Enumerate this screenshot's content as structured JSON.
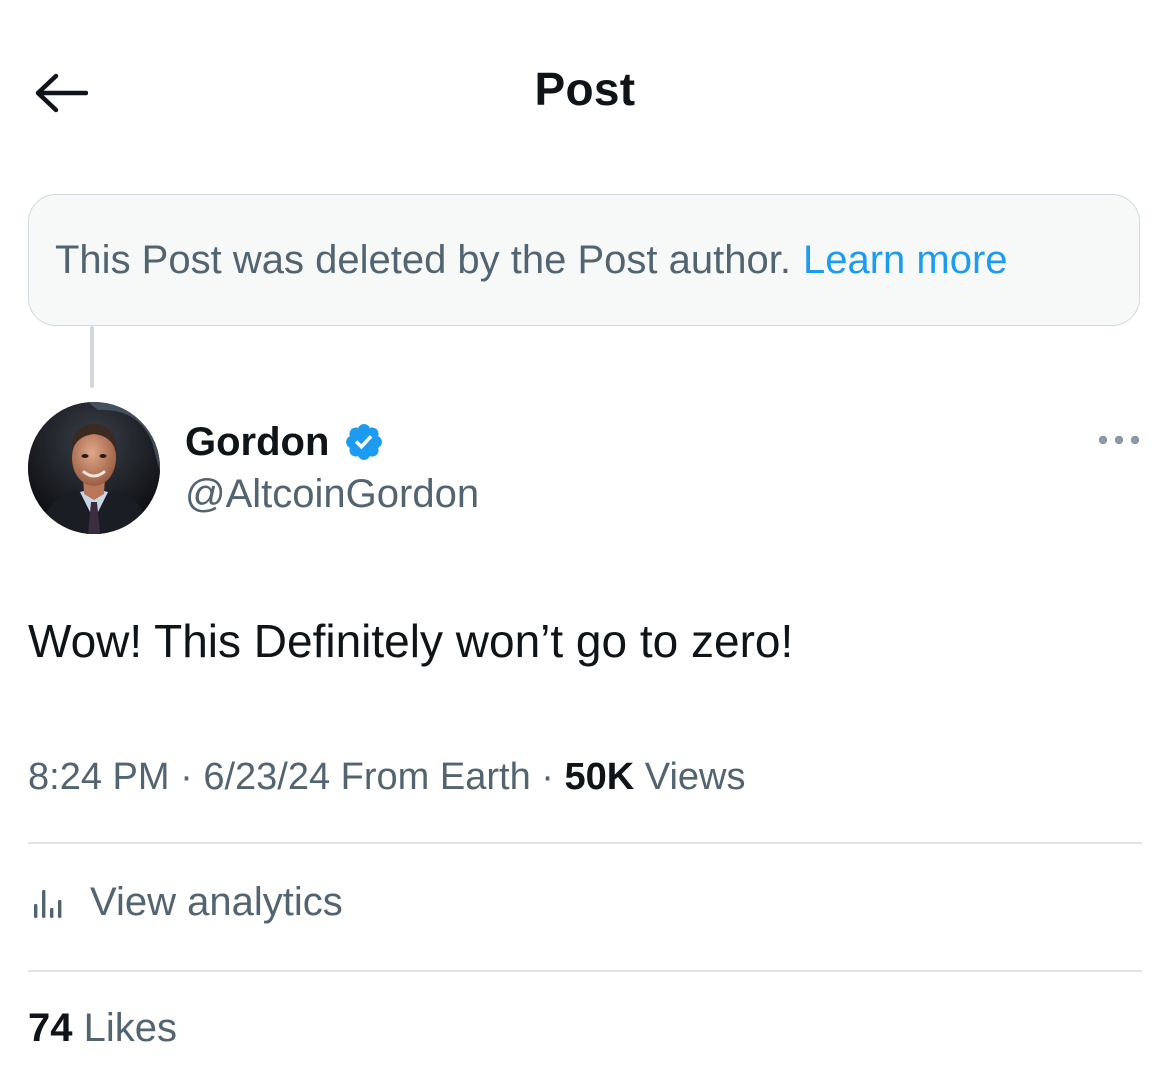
{
  "header": {
    "title": "Post",
    "back_icon": "arrow-left-icon"
  },
  "deleted_notice": {
    "text": "This Post was deleted by the Post author.",
    "link": "Learn more"
  },
  "post": {
    "author": {
      "name": "Gordon",
      "handle": "@AltcoinGordon",
      "verified": true,
      "verified_icon": "verified-badge-icon"
    },
    "more_icon": "more-options-icon",
    "text": "Wow! This Definitely won’t go to zero!",
    "time": "8:24 PM",
    "date": "6/23/24",
    "source": "From Earth",
    "views_count": "50K",
    "views_label": "Views",
    "sep": "·"
  },
  "analytics": {
    "icon": "bar-chart-icon",
    "label": "View analytics"
  },
  "likes": {
    "count": "74",
    "label": "Likes"
  },
  "colors": {
    "link": "#1d9bf0",
    "secondary_text": "#536471",
    "verified": "#1d9bf0",
    "notice_bg": "#f7f9f9"
  }
}
